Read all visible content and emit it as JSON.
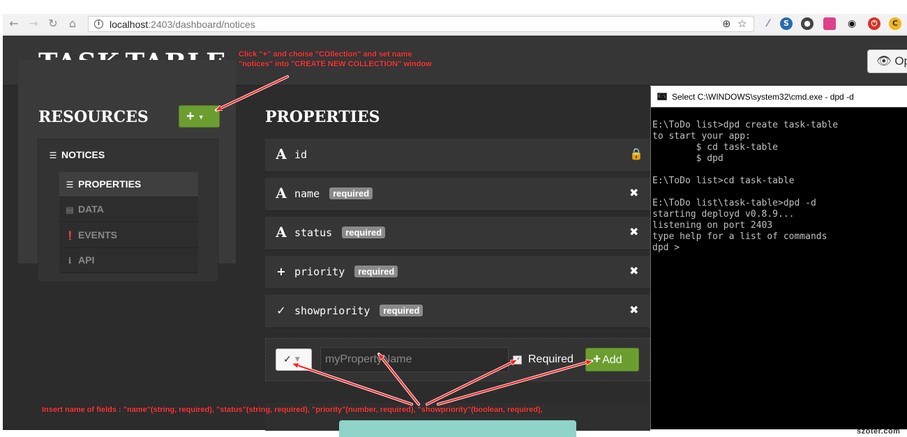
{
  "browser": {
    "url_host": "localhost",
    "url_path": ":2403/dashboard/notices",
    "icons": [
      "back-icon",
      "forward-icon",
      "reload-icon",
      "home-icon",
      "info-icon",
      "zoom-icon",
      "star-icon"
    ]
  },
  "app": {
    "logo": "TASK-TABLE",
    "open_button": "Op",
    "resources_title": "RESOURCES",
    "add_resource_label": "+",
    "properties_title": "PROPERTIES"
  },
  "tree": {
    "collection": "NOTICES",
    "items": [
      {
        "label": "PROPERTIES",
        "icon": "list-icon",
        "active": true
      },
      {
        "label": "DATA",
        "icon": "table-icon",
        "active": false
      },
      {
        "label": "EVENTS",
        "icon": "alert-icon",
        "active": false
      },
      {
        "label": "API",
        "icon": "info-icon",
        "active": false
      }
    ]
  },
  "properties": [
    {
      "type_icon": "A",
      "name": "id",
      "required": "",
      "action": "lock-icon"
    },
    {
      "type_icon": "A",
      "name": "name",
      "required": "required",
      "action": "remove-icon"
    },
    {
      "type_icon": "A",
      "name": "status",
      "required": "required",
      "action": "remove-icon"
    },
    {
      "type_icon": "+",
      "name": "priority",
      "required": "required",
      "action": "remove-icon"
    },
    {
      "type_icon": "✓",
      "name": "showpriority",
      "required": "required",
      "action": "remove-icon"
    }
  ],
  "new_property": {
    "type_icon": "✓",
    "placeholder": "myPropertyName",
    "required_checked": "✓",
    "required_label": "Required",
    "add_label": "Add",
    "add_icon": "+"
  },
  "annotations": {
    "top_line1": "Click \"+\" and choise \"COllection\"  and set name",
    "top_line2": "\"notices\" into \"CREATE NEW COLLECTION\" window",
    "bottom": "Insert name of fields :  \"name\"(string, required), \"status\"(string, required), \"priority\"(number, required), \"showpriority\"(boolean, required),"
  },
  "cmd": {
    "title": "Select C:\\WINDOWS\\system32\\cmd.exe - dpd  -d",
    "lines": [
      "E:\\ToDo list>dpd create task-table",
      "to start your app:",
      "        $ cd task-table",
      "        $ dpd",
      "",
      "E:\\ToDo list>cd task-table",
      "",
      "E:\\ToDo list\\task-table>dpd -d",
      "starting deployd v0.8.9...",
      "listening on port 2403",
      "type help for a list of commands",
      "dpd >"
    ]
  },
  "watermark": "szoter.com",
  "colors": {
    "accent_green": "#6b9e2f",
    "annotation_red": "#ff3c3c",
    "badge_grey": "#8a8a8a"
  }
}
